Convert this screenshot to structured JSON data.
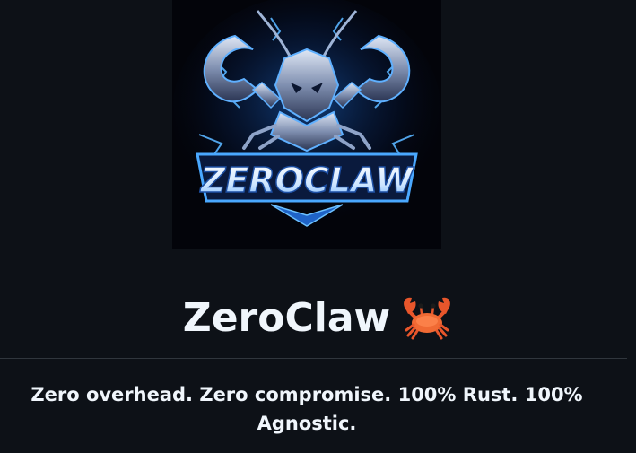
{
  "logo": {
    "wordmark": "ZEROCLAW",
    "icon": "zeroclaw-crab-logo"
  },
  "header": {
    "title": "ZeroClaw",
    "title_icon": "crab-icon"
  },
  "tagline": {
    "text": "Zero overhead. Zero compromise. 100% Rust. 100% Agnostic."
  },
  "colors": {
    "background": "#0d1117",
    "text": "#f0f6fc",
    "divider": "#30363d",
    "logo_glow": "#3aa0ff"
  }
}
